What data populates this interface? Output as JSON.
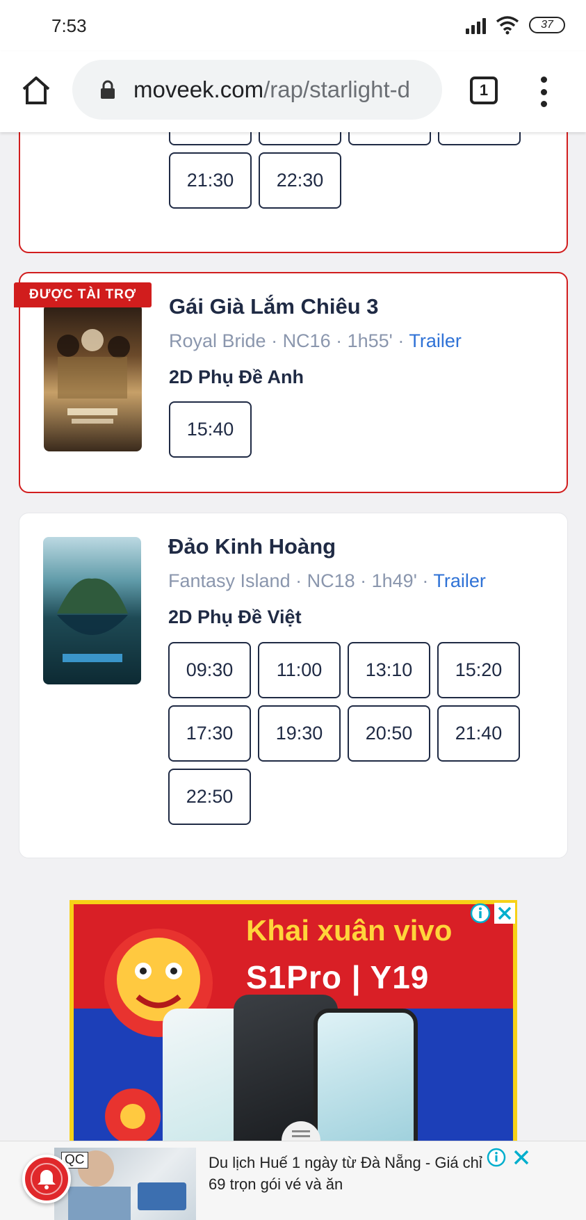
{
  "status_bar": {
    "time": "7:53",
    "battery": "37"
  },
  "browser": {
    "url_host": "moveek.com",
    "url_path": "/rap/starlight-d",
    "tab_count": "1"
  },
  "sponsored_label": "ĐƯỢC TÀI TRỢ",
  "prev_movie": {
    "times_row2": [
      "21:30",
      "22:30"
    ]
  },
  "movie1": {
    "title": "Gái Già Lắm Chiêu 3",
    "original_title": "Royal Bride",
    "rating": "NC16",
    "duration": "1h55'",
    "trailer": "Trailer",
    "separator": " · ",
    "format": "2D Phụ Đề Anh",
    "times": [
      "15:40"
    ]
  },
  "movie2": {
    "title": "Đảo Kinh Hoàng",
    "original_title": "Fantasy Island",
    "rating": "NC18",
    "duration": "1h49'",
    "trailer": "Trailer",
    "separator": " · ",
    "format": "2D Phụ Đề Việt",
    "times": [
      "09:30",
      "11:00",
      "13:10",
      "15:20",
      "17:30",
      "19:30",
      "20:50",
      "21:40",
      "22:50"
    ]
  },
  "ad": {
    "headline": "Khai xuân vivo",
    "models": "S1Pro | Y19"
  },
  "bottom_ad": {
    "label": "QC",
    "text": "Du lịch Huế 1 ngày từ Đà Nẵng - Giá chỉ 69 trọn gói vé và ăn"
  },
  "colors": {
    "accent_red": "#d11d1d",
    "link_blue": "#2f72d6",
    "navy": "#1f2a44",
    "meta_gray": "#8a96ad"
  }
}
